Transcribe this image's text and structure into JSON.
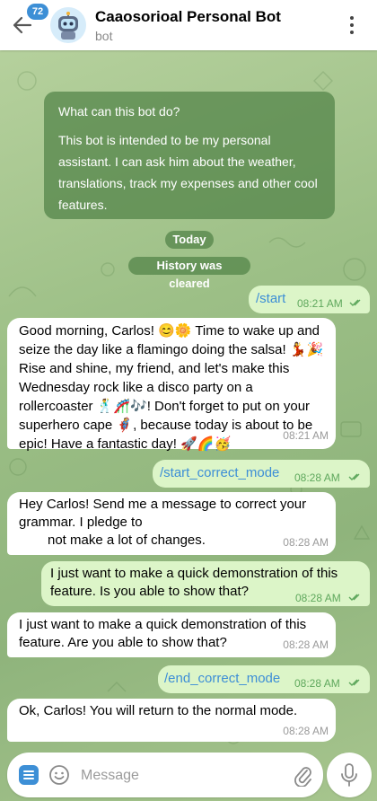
{
  "header": {
    "back_icon": "arrow-left-icon",
    "unread_count": "72",
    "title": "Caaosorioal Personal Bot",
    "status": "bot",
    "menu_icon": "more-vertical-icon",
    "avatar_icon": "robot-avatar-icon"
  },
  "info_card": {
    "title": "What can this bot do?",
    "body": "This bot is intended to be my personal assistant. I can ask him about the weather, translations, track my expenses and other cool features."
  },
  "date_divider": "Today",
  "service_message": "History was cleared",
  "messages": [
    {
      "direction": "out",
      "text": "/start",
      "time": "08:21 AM",
      "is_command": true
    },
    {
      "direction": "in",
      "text": "Good morning, Carlos! 😊🌼 Time to wake up and seize the day like a flamingo doing the salsa! 💃🎉 Rise and shine, my friend, and let's make this Wednesday rock like a disco party on a rollercoaster 🕺🎢🎶! Don't forget to put on your superhero cape 🦸, because today is about to be epic! Have a fantastic day! 🚀🌈🥳",
      "time": "08:21 AM"
    },
    {
      "direction": "out",
      "text": "/start_correct_mode",
      "time": "08:28 AM",
      "is_command": true
    },
    {
      "direction": "in",
      "text_line1": "Hey Carlos! Send me a message to correct your grammar. I pledge to",
      "text_line2": "not make a lot of changes.",
      "time": "08:28 AM"
    },
    {
      "direction": "out",
      "text": "I just want to make a quick demonstration of this feature. Is you able to show that?",
      "time": "08:28 AM"
    },
    {
      "direction": "in",
      "text": "I just want to make a quick demonstration of this feature. Are you able to show that?",
      "time": "08:28 AM"
    },
    {
      "direction": "out",
      "text": "/end_correct_mode",
      "time": "08:28 AM",
      "is_command": true
    },
    {
      "direction": "in",
      "text": "Ok, Carlos! You will return to the normal mode.",
      "time": "08:28 AM"
    }
  ],
  "input_bar": {
    "placeholder": "Message",
    "menu_icon": "bot-menu-icon",
    "emoji_icon": "smile-icon",
    "attach_icon": "paperclip-icon",
    "mic_icon": "microphone-icon"
  },
  "colors": {
    "accent": "#3d8fd6",
    "outgoing_bubble": "#dcf5c8",
    "incoming_bubble": "#ffffff",
    "outgoing_time": "#5fa85d",
    "service_bg": "#50824677"
  }
}
